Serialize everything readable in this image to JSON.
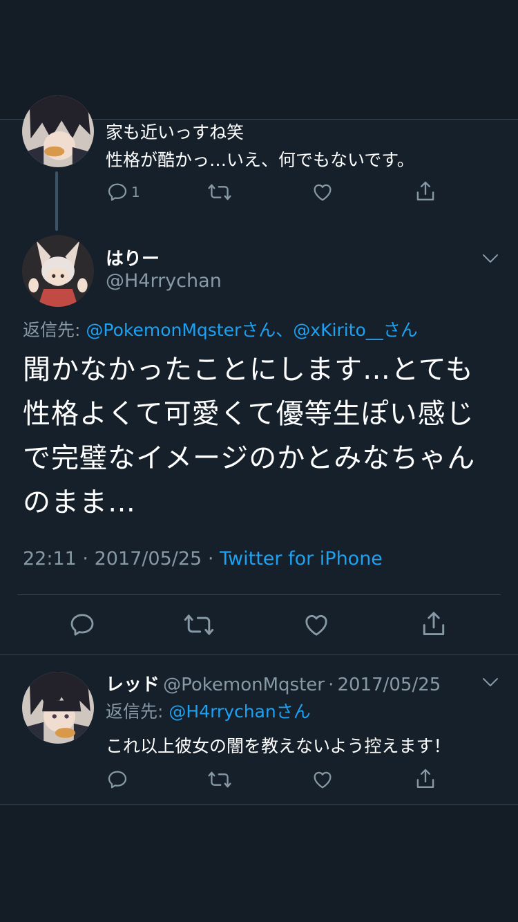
{
  "prev_tweet": {
    "text_line1": "家も近いっすね笑",
    "text_line2": "性格が酷かっ…いえ、何でもないです。",
    "reply_count": "1"
  },
  "main_tweet": {
    "name": "はりー",
    "handle": "@H4rrychan",
    "reply_to_label": "返信先:",
    "reply_to_1": "@PokemonMqsterさん",
    "reply_to_sep": "、",
    "reply_to_2": "@xKirito__さん",
    "body": "聞かなかったことにします…とても性格よくて可愛くて優等生ぽい感じで完璧なイメージのかとみなちゃんのまま…",
    "time": "22:11",
    "dot1": "·",
    "date": "2017/05/25",
    "dot2": "·",
    "source": "Twitter for iPhone"
  },
  "reply_tweet": {
    "name": "レッド",
    "handle": "@PokemonMqster",
    "dot": "·",
    "date": "2017/05/25",
    "reply_to_label": "返信先:",
    "reply_to": "@H4rrychanさん",
    "text": "これ以上彼女の闇を教えないよう控えます！"
  },
  "icons": [
    "reply-icon",
    "retweet-icon",
    "like-icon",
    "share-icon",
    "chevron-down-icon"
  ],
  "colors": {
    "background": "#15202b",
    "link": "#1da1f2",
    "muted": "#8899a6",
    "divider": "#38444d"
  }
}
